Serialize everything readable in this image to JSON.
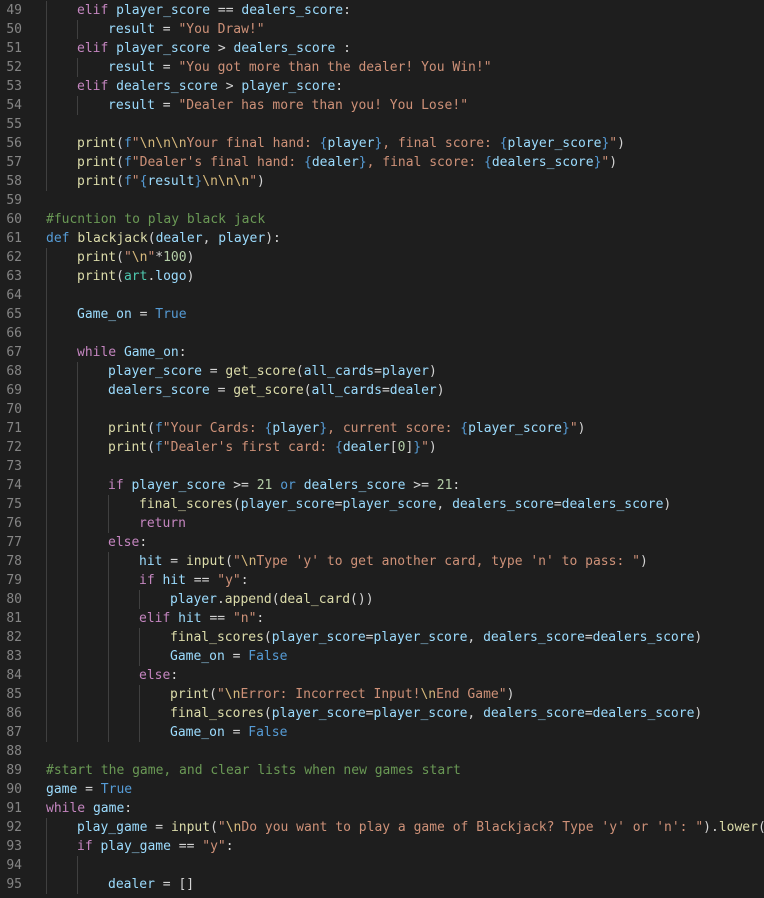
{
  "theme": {
    "background": "#1e1e1e",
    "line_number_color": "#858585",
    "keyword": "#569cd6",
    "control": "#c586c0",
    "variable": "#9cdcfe",
    "function": "#dcdcaa",
    "string": "#ce9178",
    "escape": "#d7ba7d",
    "number": "#b5cea8",
    "comment": "#6a9955"
  },
  "lines": [
    {
      "n": "49",
      "indent": 1,
      "tokens": [
        [
          "ctl",
          "elif"
        ],
        [
          "pun",
          " "
        ],
        [
          "var",
          "player_score"
        ],
        [
          "op",
          " == "
        ],
        [
          "var",
          "dealers_score"
        ],
        [
          "pun",
          ":"
        ]
      ]
    },
    {
      "n": "50",
      "indent": 2,
      "tokens": [
        [
          "var",
          "result"
        ],
        [
          "op",
          " = "
        ],
        [
          "str",
          "\"You Draw!\""
        ]
      ]
    },
    {
      "n": "51",
      "indent": 1,
      "tokens": [
        [
          "ctl",
          "elif"
        ],
        [
          "pun",
          " "
        ],
        [
          "var",
          "player_score"
        ],
        [
          "op",
          " > "
        ],
        [
          "var",
          "dealers_score"
        ],
        [
          "pun",
          " :"
        ]
      ]
    },
    {
      "n": "52",
      "indent": 2,
      "tokens": [
        [
          "var",
          "result"
        ],
        [
          "op",
          " = "
        ],
        [
          "str",
          "\"You got more than the dealer! You Win!\""
        ]
      ]
    },
    {
      "n": "53",
      "indent": 1,
      "tokens": [
        [
          "ctl",
          "elif"
        ],
        [
          "pun",
          " "
        ],
        [
          "var",
          "dealers_score"
        ],
        [
          "op",
          " > "
        ],
        [
          "var",
          "player_score"
        ],
        [
          "pun",
          ":"
        ]
      ]
    },
    {
      "n": "54",
      "indent": 2,
      "tokens": [
        [
          "var",
          "result"
        ],
        [
          "op",
          " = "
        ],
        [
          "str",
          "\"Dealer has more than you! You Lose!\""
        ]
      ]
    },
    {
      "n": "55",
      "indent": 1,
      "tokens": []
    },
    {
      "n": "56",
      "indent": 1,
      "tokens": [
        [
          "fn",
          "print"
        ],
        [
          "pun",
          "("
        ],
        [
          "kw",
          "f"
        ],
        [
          "str",
          "\""
        ],
        [
          "esc",
          "\\n\\n\\n"
        ],
        [
          "str",
          "Your final hand: "
        ],
        [
          "kw",
          "{"
        ],
        [
          "var",
          "player"
        ],
        [
          "kw",
          "}"
        ],
        [
          "str",
          ", final score: "
        ],
        [
          "kw",
          "{"
        ],
        [
          "var",
          "player_score"
        ],
        [
          "kw",
          "}"
        ],
        [
          "str",
          "\""
        ],
        [
          "pun",
          ")"
        ]
      ]
    },
    {
      "n": "57",
      "indent": 1,
      "tokens": [
        [
          "fn",
          "print"
        ],
        [
          "pun",
          "("
        ],
        [
          "kw",
          "f"
        ],
        [
          "str",
          "\"Dealer's final hand: "
        ],
        [
          "kw",
          "{"
        ],
        [
          "var",
          "dealer"
        ],
        [
          "kw",
          "}"
        ],
        [
          "str",
          ", final score: "
        ],
        [
          "kw",
          "{"
        ],
        [
          "var",
          "dealers_score"
        ],
        [
          "kw",
          "}"
        ],
        [
          "str",
          "\""
        ],
        [
          "pun",
          ")"
        ]
      ]
    },
    {
      "n": "58",
      "indent": 1,
      "tokens": [
        [
          "fn",
          "print"
        ],
        [
          "pun",
          "("
        ],
        [
          "kw",
          "f"
        ],
        [
          "str",
          "\""
        ],
        [
          "kw",
          "{"
        ],
        [
          "var",
          "result"
        ],
        [
          "kw",
          "}"
        ],
        [
          "esc",
          "\\n\\n\\n"
        ],
        [
          "str",
          "\""
        ],
        [
          "pun",
          ")"
        ]
      ]
    },
    {
      "n": "59",
      "indent": 0,
      "tokens": []
    },
    {
      "n": "60",
      "indent": 0,
      "tokens": [
        [
          "cmt",
          "#fucntion to play black jack"
        ]
      ]
    },
    {
      "n": "61",
      "indent": 0,
      "tokens": [
        [
          "kw",
          "def"
        ],
        [
          "pun",
          " "
        ],
        [
          "fn",
          "blackjack"
        ],
        [
          "pun",
          "("
        ],
        [
          "var",
          "dealer"
        ],
        [
          "pun",
          ", "
        ],
        [
          "var",
          "player"
        ],
        [
          "pun",
          "):"
        ]
      ]
    },
    {
      "n": "62",
      "indent": 1,
      "tokens": [
        [
          "fn",
          "print"
        ],
        [
          "pun",
          "("
        ],
        [
          "str",
          "\""
        ],
        [
          "esc",
          "\\n"
        ],
        [
          "str",
          "\""
        ],
        [
          "op",
          "*"
        ],
        [
          "num",
          "100"
        ],
        [
          "pun",
          ")"
        ]
      ]
    },
    {
      "n": "63",
      "indent": 1,
      "tokens": [
        [
          "fn",
          "print"
        ],
        [
          "pun",
          "("
        ],
        [
          "cls",
          "art"
        ],
        [
          "pun",
          "."
        ],
        [
          "var",
          "logo"
        ],
        [
          "pun",
          ")"
        ]
      ]
    },
    {
      "n": "64",
      "indent": 1,
      "tokens": []
    },
    {
      "n": "65",
      "indent": 1,
      "tokens": [
        [
          "var",
          "Game_on"
        ],
        [
          "op",
          " = "
        ],
        [
          "kw",
          "True"
        ]
      ]
    },
    {
      "n": "66",
      "indent": 1,
      "tokens": []
    },
    {
      "n": "67",
      "indent": 1,
      "tokens": [
        [
          "ctl",
          "while"
        ],
        [
          "pun",
          " "
        ],
        [
          "var",
          "Game_on"
        ],
        [
          "pun",
          ":"
        ]
      ]
    },
    {
      "n": "68",
      "indent": 2,
      "tokens": [
        [
          "var",
          "player_score"
        ],
        [
          "op",
          " = "
        ],
        [
          "fn",
          "get_score"
        ],
        [
          "pun",
          "("
        ],
        [
          "var",
          "all_cards"
        ],
        [
          "op",
          "="
        ],
        [
          "var",
          "player"
        ],
        [
          "pun",
          ")"
        ]
      ]
    },
    {
      "n": "69",
      "indent": 2,
      "tokens": [
        [
          "var",
          "dealers_score"
        ],
        [
          "op",
          " = "
        ],
        [
          "fn",
          "get_score"
        ],
        [
          "pun",
          "("
        ],
        [
          "var",
          "all_cards"
        ],
        [
          "op",
          "="
        ],
        [
          "var",
          "dealer"
        ],
        [
          "pun",
          ")"
        ]
      ]
    },
    {
      "n": "70",
      "indent": 2,
      "tokens": []
    },
    {
      "n": "71",
      "indent": 2,
      "tokens": [
        [
          "fn",
          "print"
        ],
        [
          "pun",
          "("
        ],
        [
          "kw",
          "f"
        ],
        [
          "str",
          "\"Your Cards: "
        ],
        [
          "kw",
          "{"
        ],
        [
          "var",
          "player"
        ],
        [
          "kw",
          "}"
        ],
        [
          "str",
          ", current score: "
        ],
        [
          "kw",
          "{"
        ],
        [
          "var",
          "player_score"
        ],
        [
          "kw",
          "}"
        ],
        [
          "str",
          "\""
        ],
        [
          "pun",
          ")"
        ]
      ]
    },
    {
      "n": "72",
      "indent": 2,
      "tokens": [
        [
          "fn",
          "print"
        ],
        [
          "pun",
          "("
        ],
        [
          "kw",
          "f"
        ],
        [
          "str",
          "\"Dealer's first card: "
        ],
        [
          "kw",
          "{"
        ],
        [
          "var",
          "dealer"
        ],
        [
          "pun",
          "["
        ],
        [
          "num",
          "0"
        ],
        [
          "pun",
          "]"
        ],
        [
          "kw",
          "}"
        ],
        [
          "str",
          "\""
        ],
        [
          "pun",
          ")"
        ]
      ]
    },
    {
      "n": "73",
      "indent": 2,
      "tokens": []
    },
    {
      "n": "74",
      "indent": 2,
      "tokens": [
        [
          "ctl",
          "if"
        ],
        [
          "pun",
          " "
        ],
        [
          "var",
          "player_score"
        ],
        [
          "op",
          " >= "
        ],
        [
          "num",
          "21"
        ],
        [
          "pun",
          " "
        ],
        [
          "kw",
          "or"
        ],
        [
          "pun",
          " "
        ],
        [
          "var",
          "dealers_score"
        ],
        [
          "op",
          " >= "
        ],
        [
          "num",
          "21"
        ],
        [
          "pun",
          ":"
        ]
      ]
    },
    {
      "n": "75",
      "indent": 3,
      "tokens": [
        [
          "fn",
          "final_scores"
        ],
        [
          "pun",
          "("
        ],
        [
          "var",
          "player_score"
        ],
        [
          "op",
          "="
        ],
        [
          "var",
          "player_score"
        ],
        [
          "pun",
          ", "
        ],
        [
          "var",
          "dealers_score"
        ],
        [
          "op",
          "="
        ],
        [
          "var",
          "dealers_score"
        ],
        [
          "pun",
          ")"
        ]
      ]
    },
    {
      "n": "76",
      "indent": 3,
      "tokens": [
        [
          "ctl",
          "return"
        ]
      ]
    },
    {
      "n": "77",
      "indent": 2,
      "tokens": [
        [
          "ctl",
          "else"
        ],
        [
          "pun",
          ":"
        ]
      ]
    },
    {
      "n": "78",
      "indent": 3,
      "tokens": [
        [
          "var",
          "hit"
        ],
        [
          "op",
          " = "
        ],
        [
          "fn",
          "input"
        ],
        [
          "pun",
          "("
        ],
        [
          "str",
          "\""
        ],
        [
          "esc",
          "\\n"
        ],
        [
          "str",
          "Type 'y' to get another card, type 'n' to pass: \""
        ],
        [
          "pun",
          ")"
        ]
      ]
    },
    {
      "n": "79",
      "indent": 3,
      "tokens": [
        [
          "ctl",
          "if"
        ],
        [
          "pun",
          " "
        ],
        [
          "var",
          "hit"
        ],
        [
          "op",
          " == "
        ],
        [
          "str",
          "\"y\""
        ],
        [
          "pun",
          ":"
        ]
      ]
    },
    {
      "n": "80",
      "indent": 4,
      "tokens": [
        [
          "var",
          "player"
        ],
        [
          "pun",
          "."
        ],
        [
          "fn",
          "append"
        ],
        [
          "pun",
          "("
        ],
        [
          "fn",
          "deal_card"
        ],
        [
          "pun",
          "())"
        ]
      ]
    },
    {
      "n": "81",
      "indent": 3,
      "tokens": [
        [
          "ctl",
          "elif"
        ],
        [
          "pun",
          " "
        ],
        [
          "var",
          "hit"
        ],
        [
          "op",
          " == "
        ],
        [
          "str",
          "\"n\""
        ],
        [
          "pun",
          ":"
        ]
      ]
    },
    {
      "n": "82",
      "indent": 4,
      "tokens": [
        [
          "fn",
          "final_scores"
        ],
        [
          "pun",
          "("
        ],
        [
          "var",
          "player_score"
        ],
        [
          "op",
          "="
        ],
        [
          "var",
          "player_score"
        ],
        [
          "pun",
          ", "
        ],
        [
          "var",
          "dealers_score"
        ],
        [
          "op",
          "="
        ],
        [
          "var",
          "dealers_score"
        ],
        [
          "pun",
          ")"
        ]
      ]
    },
    {
      "n": "83",
      "indent": 4,
      "tokens": [
        [
          "var",
          "Game_on"
        ],
        [
          "op",
          " = "
        ],
        [
          "kw",
          "False"
        ]
      ]
    },
    {
      "n": "84",
      "indent": 3,
      "tokens": [
        [
          "ctl",
          "else"
        ],
        [
          "pun",
          ":"
        ]
      ]
    },
    {
      "n": "85",
      "indent": 4,
      "tokens": [
        [
          "fn",
          "print"
        ],
        [
          "pun",
          "("
        ],
        [
          "str",
          "\""
        ],
        [
          "esc",
          "\\n"
        ],
        [
          "str",
          "Error: Incorrect Input!"
        ],
        [
          "esc",
          "\\n"
        ],
        [
          "str",
          "End Game\""
        ],
        [
          "pun",
          ")"
        ]
      ]
    },
    {
      "n": "86",
      "indent": 4,
      "tokens": [
        [
          "fn",
          "final_scores"
        ],
        [
          "pun",
          "("
        ],
        [
          "var",
          "player_score"
        ],
        [
          "op",
          "="
        ],
        [
          "var",
          "player_score"
        ],
        [
          "pun",
          ", "
        ],
        [
          "var",
          "dealers_score"
        ],
        [
          "op",
          "="
        ],
        [
          "var",
          "dealers_score"
        ],
        [
          "pun",
          ")"
        ]
      ]
    },
    {
      "n": "87",
      "indent": 4,
      "tokens": [
        [
          "var",
          "Game_on"
        ],
        [
          "op",
          " = "
        ],
        [
          "kw",
          "False"
        ]
      ]
    },
    {
      "n": "88",
      "indent": 0,
      "tokens": []
    },
    {
      "n": "89",
      "indent": 0,
      "tokens": [
        [
          "cmt",
          "#start the game, and clear lists when new games start"
        ]
      ]
    },
    {
      "n": "90",
      "indent": 0,
      "tokens": [
        [
          "var",
          "game"
        ],
        [
          "op",
          " = "
        ],
        [
          "kw",
          "True"
        ]
      ]
    },
    {
      "n": "91",
      "indent": 0,
      "tokens": [
        [
          "ctl",
          "while"
        ],
        [
          "pun",
          " "
        ],
        [
          "var",
          "game"
        ],
        [
          "pun",
          ":"
        ]
      ]
    },
    {
      "n": "92",
      "indent": 1,
      "tokens": [
        [
          "var",
          "play_game"
        ],
        [
          "op",
          " = "
        ],
        [
          "fn",
          "input"
        ],
        [
          "pun",
          "("
        ],
        [
          "str",
          "\""
        ],
        [
          "esc",
          "\\n"
        ],
        [
          "str",
          "Do you want to play a game of Blackjack? Type 'y' or 'n': \""
        ],
        [
          "pun",
          ")."
        ],
        [
          "fn",
          "lower"
        ],
        [
          "pun",
          "()"
        ]
      ]
    },
    {
      "n": "93",
      "indent": 1,
      "tokens": [
        [
          "ctl",
          "if"
        ],
        [
          "pun",
          " "
        ],
        [
          "var",
          "play_game"
        ],
        [
          "op",
          " == "
        ],
        [
          "str",
          "\"y\""
        ],
        [
          "pun",
          ":"
        ]
      ]
    },
    {
      "n": "94",
      "indent": 2,
      "tokens": []
    },
    {
      "n": "95",
      "indent": 2,
      "tokens": [
        [
          "var",
          "dealer"
        ],
        [
          "op",
          " = "
        ],
        [
          "pun",
          "[]"
        ]
      ]
    }
  ]
}
